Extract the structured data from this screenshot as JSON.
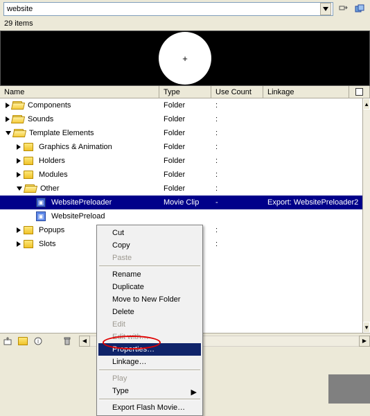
{
  "search": {
    "value": "website"
  },
  "count_label": "29 items",
  "preview_marker": "+",
  "columns": {
    "name": "Name",
    "type": "Type",
    "use": "Use Count",
    "linkage": "Linkage"
  },
  "rows": [
    {
      "name": "Components",
      "type": "Folder",
      "use": ":",
      "linkage": "",
      "indent": 0,
      "icon": "folder-open",
      "tri": "right"
    },
    {
      "name": "Sounds",
      "type": "Folder",
      "use": ":",
      "linkage": "",
      "indent": 0,
      "icon": "folder-open",
      "tri": "right"
    },
    {
      "name": "Template Elements",
      "type": "Folder",
      "use": ":",
      "linkage": "",
      "indent": 0,
      "icon": "folder-open",
      "tri": "down"
    },
    {
      "name": "Graphics & Animation",
      "type": "Folder",
      "use": ":",
      "linkage": "",
      "indent": 1,
      "icon": "folder",
      "tri": "right"
    },
    {
      "name": "Holders",
      "type": "Folder",
      "use": ":",
      "linkage": "",
      "indent": 1,
      "icon": "folder",
      "tri": "right"
    },
    {
      "name": "Modules",
      "type": "Folder",
      "use": ":",
      "linkage": "",
      "indent": 1,
      "icon": "folder",
      "tri": "right"
    },
    {
      "name": "Other",
      "type": "Folder",
      "use": ":",
      "linkage": "",
      "indent": 1,
      "icon": "folder-open",
      "tri": "down"
    },
    {
      "name": "WebsitePreloader",
      "type": "Movie Clip",
      "use": "-",
      "linkage": "Export: WebsitePreloader",
      "indent": 2,
      "icon": "movieclip",
      "tri": "",
      "selected": true,
      "end": "2"
    },
    {
      "name": "WebsitePreload",
      "type": "",
      "use": "",
      "linkage": "",
      "indent": 2,
      "icon": "movieclip-light",
      "tri": ""
    },
    {
      "name": "Popups",
      "type": "",
      "use": ":",
      "linkage": "",
      "indent": 1,
      "icon": "folder",
      "tri": "right"
    },
    {
      "name": "Slots",
      "type": "",
      "use": ":",
      "linkage": "",
      "indent": 1,
      "icon": "folder",
      "tri": "right"
    }
  ],
  "menu": {
    "cut": "Cut",
    "copy": "Copy",
    "paste": "Paste",
    "rename": "Rename",
    "duplicate": "Duplicate",
    "move": "Move to New Folder",
    "delete": "Delete",
    "edit": "Edit",
    "edit_with": "Edit with…",
    "properties": "Properties…",
    "linkage": "Linkage…",
    "play": "Play",
    "type": "Type",
    "export": "Export Flash Movie…"
  }
}
